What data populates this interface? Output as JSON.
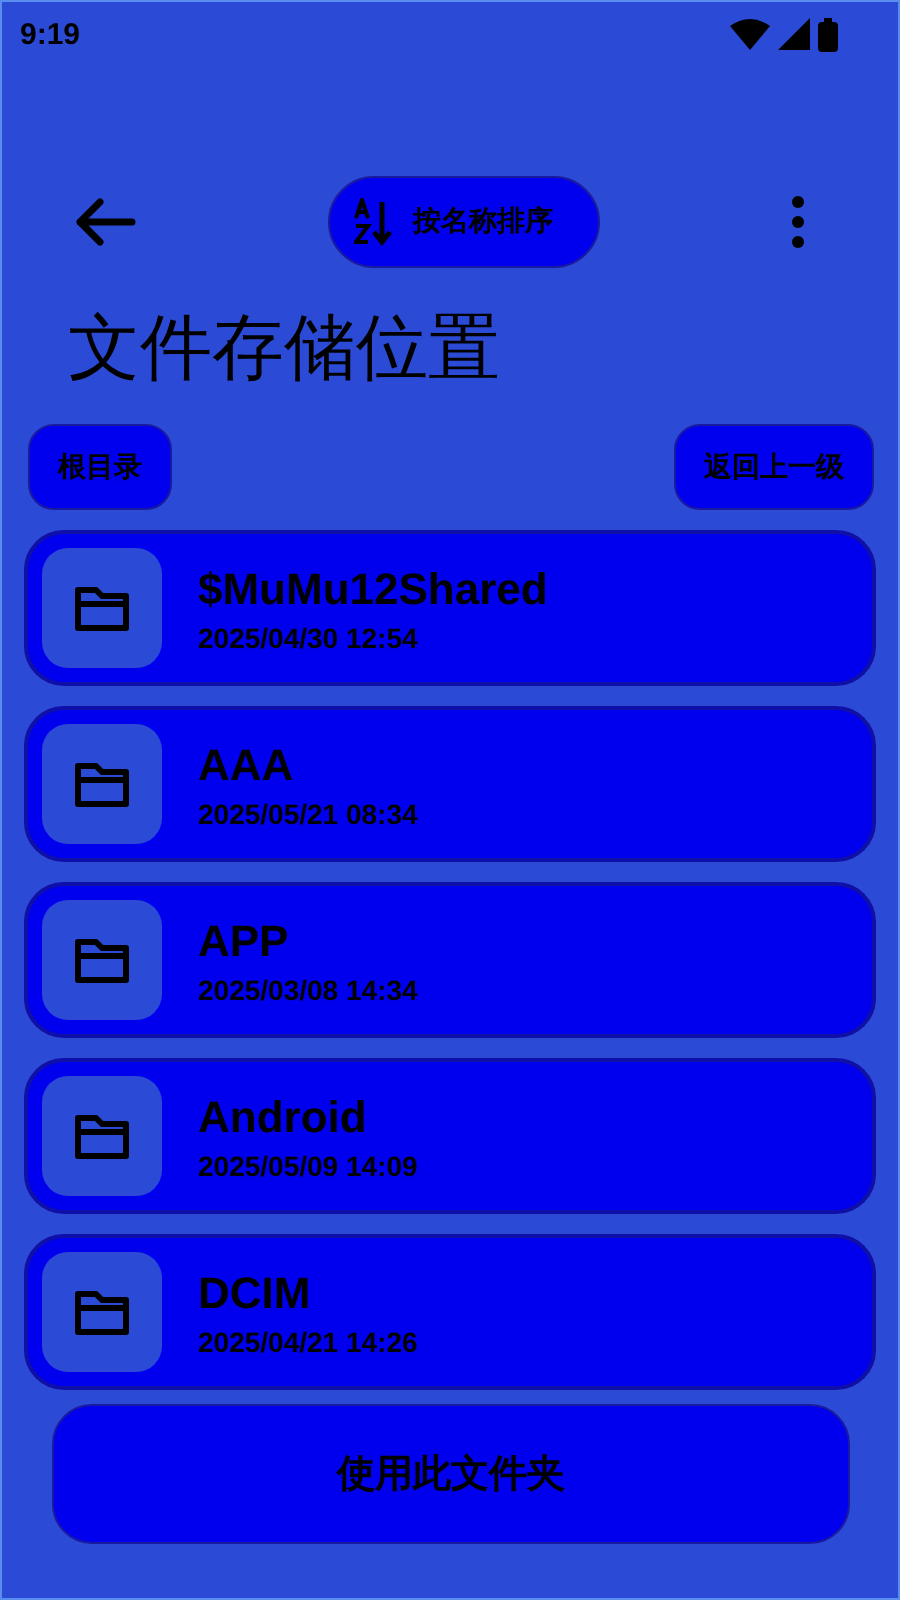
{
  "status_bar": {
    "time": "9:19"
  },
  "toolbar": {
    "sort_button": "按名称排序"
  },
  "title": "文件存储位置",
  "nav_buttons": [
    "根目录",
    "返回上一级"
  ],
  "folders": [
    {
      "name": "$MuMu12Shared",
      "modified": "2025/04/30 12:54"
    },
    {
      "name": "AAA",
      "modified": "2025/05/21 08:34"
    },
    {
      "name": "APP",
      "modified": "2025/03/08 14:34"
    },
    {
      "name": "Android",
      "modified": "2025/05/09 14:09"
    },
    {
      "name": "DCIM",
      "modified": "2025/04/21 14:26"
    }
  ],
  "primary_button": "使用此文件夹"
}
